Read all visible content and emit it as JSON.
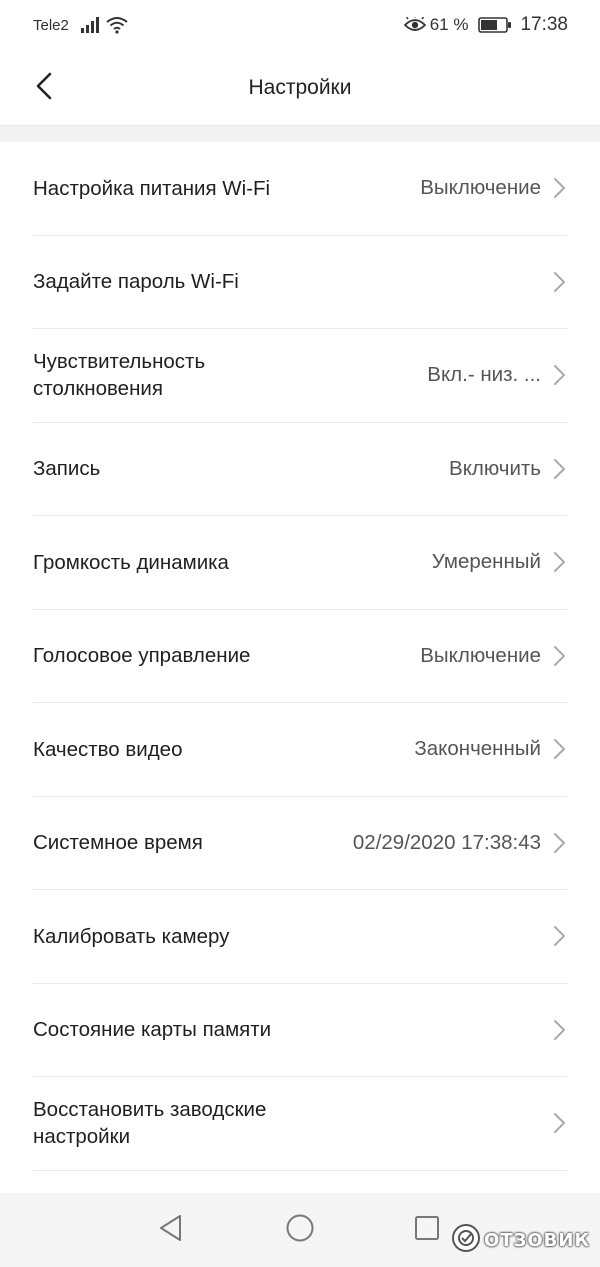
{
  "status_bar": {
    "carrier": "Tele2",
    "battery_percent": "61 %",
    "time": "17:38"
  },
  "header": {
    "title": "Настройки"
  },
  "settings": [
    {
      "label": "Настройка питания Wi-Fi",
      "value": "Выключение"
    },
    {
      "label": "Задайте пароль Wi-Fi",
      "value": ""
    },
    {
      "label": "Чувствительность\nстолкновения",
      "value": "Вкл.- низ. ..."
    },
    {
      "label": "Запись",
      "value": "Включить"
    },
    {
      "label": "Громкость динамика",
      "value": "Умеренный"
    },
    {
      "label": "Голосовое управление",
      "value": "Выключение"
    },
    {
      "label": "Качество видео",
      "value": "Законченный"
    },
    {
      "label": "Системное время",
      "value": "02/29/2020 17:38:43"
    },
    {
      "label": "Калибровать камеру",
      "value": ""
    },
    {
      "label": "Состояние карты памяти",
      "value": ""
    },
    {
      "label": "Восстановить заводские\nнастройки",
      "value": ""
    }
  ],
  "watermark": {
    "text": "ОТЗОВИК"
  },
  "icons": {
    "back": "chevron-left-icon",
    "row_arrow": "chevron-right-icon",
    "nav_back": "triangle-back-icon",
    "nav_home": "circle-home-icon",
    "nav_recent": "square-recent-icon"
  },
  "colors": {
    "background": "#ffffff",
    "divider": "#e8e8e8",
    "label": "#1f1f1f",
    "value": "#555555",
    "chevron": "#aaaaaa",
    "nav_bar": "#f5f5f5"
  }
}
